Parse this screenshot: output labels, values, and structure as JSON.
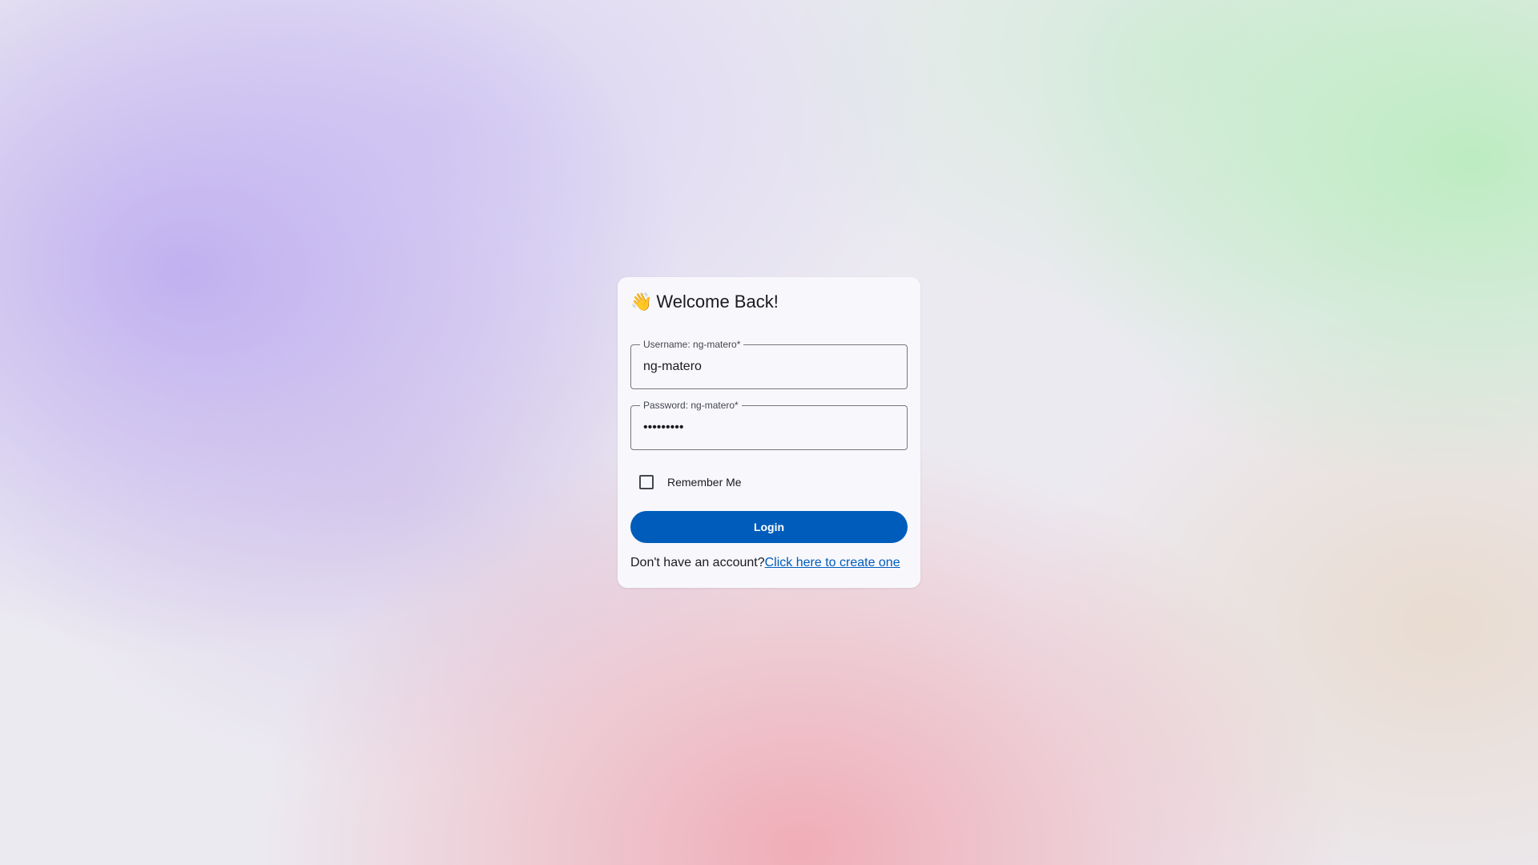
{
  "login": {
    "icon": "waving-hand-icon",
    "icon_glyph": "👋",
    "title": "Welcome Back!",
    "username": {
      "label": "Username: ng-matero*",
      "value": "ng-matero"
    },
    "password": {
      "label": "Password: ng-matero*",
      "masked_value": "•••••••••"
    },
    "remember_me": {
      "label": "Remember Me",
      "checked": false
    },
    "login_button": "Login",
    "signup_prompt": "Don't have an account?",
    "signup_link": "Click here to create one"
  },
  "colors": {
    "primary": "#005cbb",
    "card_background": "#f8f8fc",
    "outline": "#75757e"
  }
}
